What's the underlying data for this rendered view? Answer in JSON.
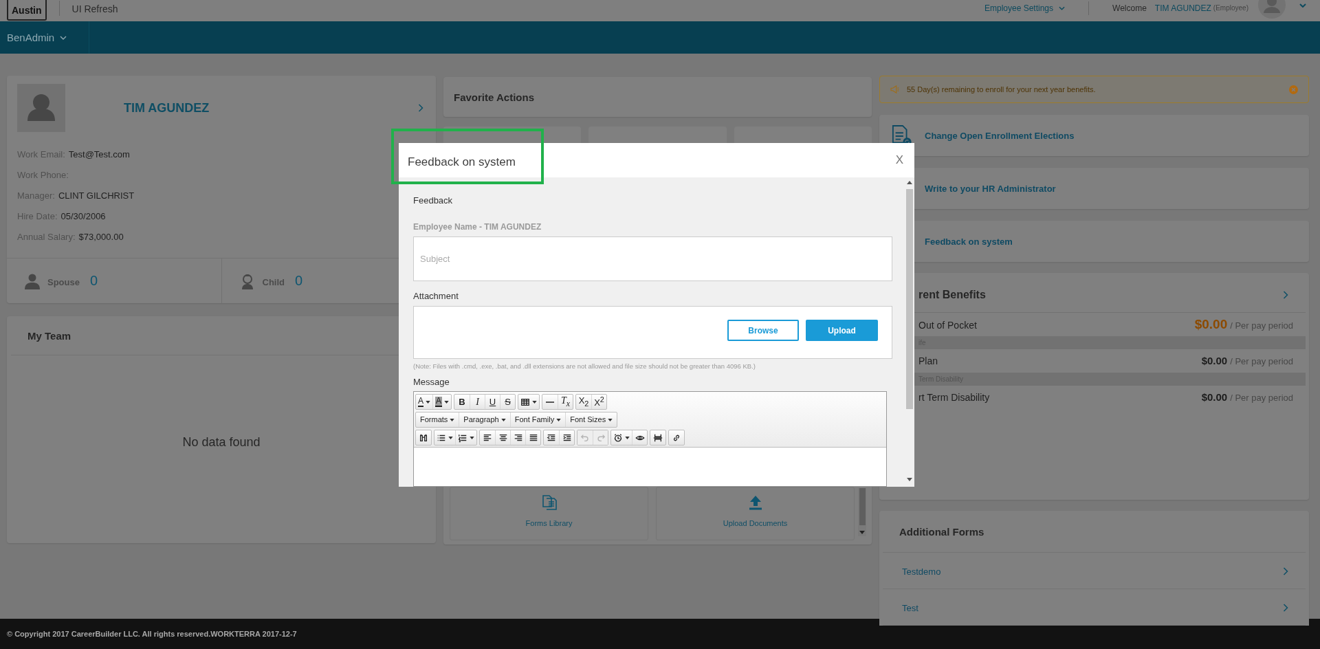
{
  "header": {
    "logo": "Austin",
    "app_name": "UI Refresh",
    "settings_menu": "Employee Settings",
    "welcome": "Welcome",
    "user_name": "TIM AGUNDEZ",
    "user_role": "(Employee)"
  },
  "nav": {
    "menu": "BenAdmin"
  },
  "profile": {
    "name": "TIM AGUNDEZ",
    "fields": [
      {
        "label": "Work Email:",
        "value": "Test@Test.com"
      },
      {
        "label": "Work Phone:"
      },
      {
        "label": "Manager:",
        "value": "CLINT GILCHRIST"
      },
      {
        "label": "Hire Date:",
        "value": "05/30/2006"
      },
      {
        "label": "Annual Salary:",
        "value": "$73,000.00"
      }
    ],
    "dependents": [
      {
        "kind": "spouse",
        "label": "Spouse",
        "count": "0"
      },
      {
        "kind": "child",
        "label": "Child",
        "count": "0"
      }
    ]
  },
  "my_team": {
    "title": "My Team",
    "empty_text": "No data found"
  },
  "favorite_actions": {
    "title": "Favorite Actions",
    "tiles": [
      {
        "kind": "forms",
        "label": "Forms Library"
      },
      {
        "kind": "upload",
        "label": "Upload Documents"
      }
    ]
  },
  "alert": {
    "text": "55 Day(s) remaining to enroll for your next year benefits."
  },
  "quick_actions": [
    {
      "kind": "document",
      "label": "Change Open Enrollment Elections"
    },
    {
      "kind": "text",
      "label": "Write to your HR Administrator"
    },
    {
      "kind": "text",
      "label": "Feedback on system"
    }
  ],
  "current_benefits": {
    "title": "rent Benefits",
    "rows": [
      {
        "kind": "plan",
        "name": "Out of Pocket",
        "amount": "$0.00",
        "period": "/ Per pay period",
        "color": "#8c4a00"
      },
      {
        "kind": "category",
        "name": "ife"
      },
      {
        "kind": "plan",
        "name": "Plan",
        "amount": "$0.00",
        "period": "/ Per pay period",
        "color": "#1c1c1c"
      },
      {
        "kind": "category",
        "name": "Term Disability"
      },
      {
        "kind": "plan",
        "name": "rt Term Disability",
        "amount": "$0.00",
        "period": "/ Per pay period",
        "color": "#1c1c1c"
      }
    ]
  },
  "additional_forms": {
    "title": "Additional Forms",
    "items": [
      "Testdemo",
      "Test"
    ]
  },
  "footer": {
    "copyright": "© Copyright 2017 CareerBuilder LLC. All rights reserved.WORKTERRA 2017-12-7"
  },
  "modal": {
    "title": "Feedback on system",
    "close": "X",
    "section": "Feedback",
    "employee_line": "Employee Name - TIM AGUNDEZ",
    "subject_placeholder": "Subject",
    "attachment_label": "Attachment",
    "browse": "Browse",
    "upload": "Upload",
    "note": "(Note: Files with .cmd, .exe, .bat, and .dll extensions are not allowed and file size should not be greater than 4096 KB.)",
    "message_label": "Message",
    "toolbar": [
      [
        [
          {
            "kind": "forecolor",
            "text": "A",
            "dropdown": true,
            "disabled": false
          },
          {
            "kind": "backcolor",
            "text": "A",
            "dropdown": true,
            "disabled": false
          }
        ],
        [
          {
            "kind": "bold",
            "text": "B",
            "dropdown": false,
            "disabled": false
          },
          {
            "kind": "italic",
            "text": "I",
            "dropdown": false,
            "disabled": false
          },
          {
            "kind": "underline",
            "text": "U",
            "dropdown": false,
            "disabled": false
          },
          {
            "kind": "strike",
            "text": "S",
            "dropdown": false,
            "disabled": false
          }
        ],
        [
          {
            "kind": "table",
            "dropdown": true,
            "disabled": false
          }
        ],
        [
          {
            "kind": "hr",
            "dropdown": false,
            "disabled": false
          },
          {
            "kind": "clear",
            "text": "T$_{x}$",
            "dropdown": false,
            "disabled": false
          }
        ],
        [
          {
            "kind": "subscript",
            "text": "X$_{2}$",
            "dropdown": false,
            "disabled": false
          },
          {
            "kind": "superscript",
            "text": "X$^{2}$",
            "dropdown": false,
            "disabled": false
          }
        ]
      ],
      [
        [
          {
            "kind": "menu",
            "text": "Formats",
            "dropdown": true,
            "disabled": false
          },
          {
            "kind": "menu",
            "text": "Paragraph",
            "dropdown": true,
            "disabled": false
          },
          {
            "kind": "menu",
            "text": "Font Family",
            "dropdown": true,
            "disabled": false
          },
          {
            "kind": "menu",
            "text": "Font Sizes",
            "dropdown": true,
            "disabled": false
          }
        ]
      ],
      [
        [
          {
            "kind": "find",
            "dropdown": false,
            "disabled": false
          }
        ],
        [
          {
            "kind": "bullist",
            "dropdown": true,
            "disabled": false
          },
          {
            "kind": "numlist",
            "dropdown": true,
            "disabled": false
          }
        ],
        [
          {
            "kind": "alignleft",
            "dropdown": false,
            "disabled": false
          },
          {
            "kind": "aligncenter",
            "dropdown": false,
            "disabled": false
          },
          {
            "kind": "alignright",
            "dropdown": false,
            "disabled": false
          },
          {
            "kind": "justify",
            "dropdown": false,
            "disabled": false
          }
        ],
        [
          {
            "kind": "outdent",
            "dropdown": false,
            "disabled": false
          },
          {
            "kind": "indent",
            "dropdown": false,
            "disabled": false
          }
        ],
        [
          {
            "kind": "undo",
            "dropdown": false,
            "disabled": true
          },
          {
            "kind": "redo",
            "dropdown": false,
            "disabled": true
          }
        ],
        [
          {
            "kind": "time",
            "dropdown": true,
            "disabled": false
          },
          {
            "kind": "preview",
            "dropdown": false,
            "disabled": false
          }
        ],
        [
          {
            "kind": "pagebreak",
            "dropdown": false,
            "disabled": false
          }
        ],
        [
          {
            "kind": "link",
            "dropdown": false,
            "disabled": false
          }
        ]
      ]
    ]
  }
}
